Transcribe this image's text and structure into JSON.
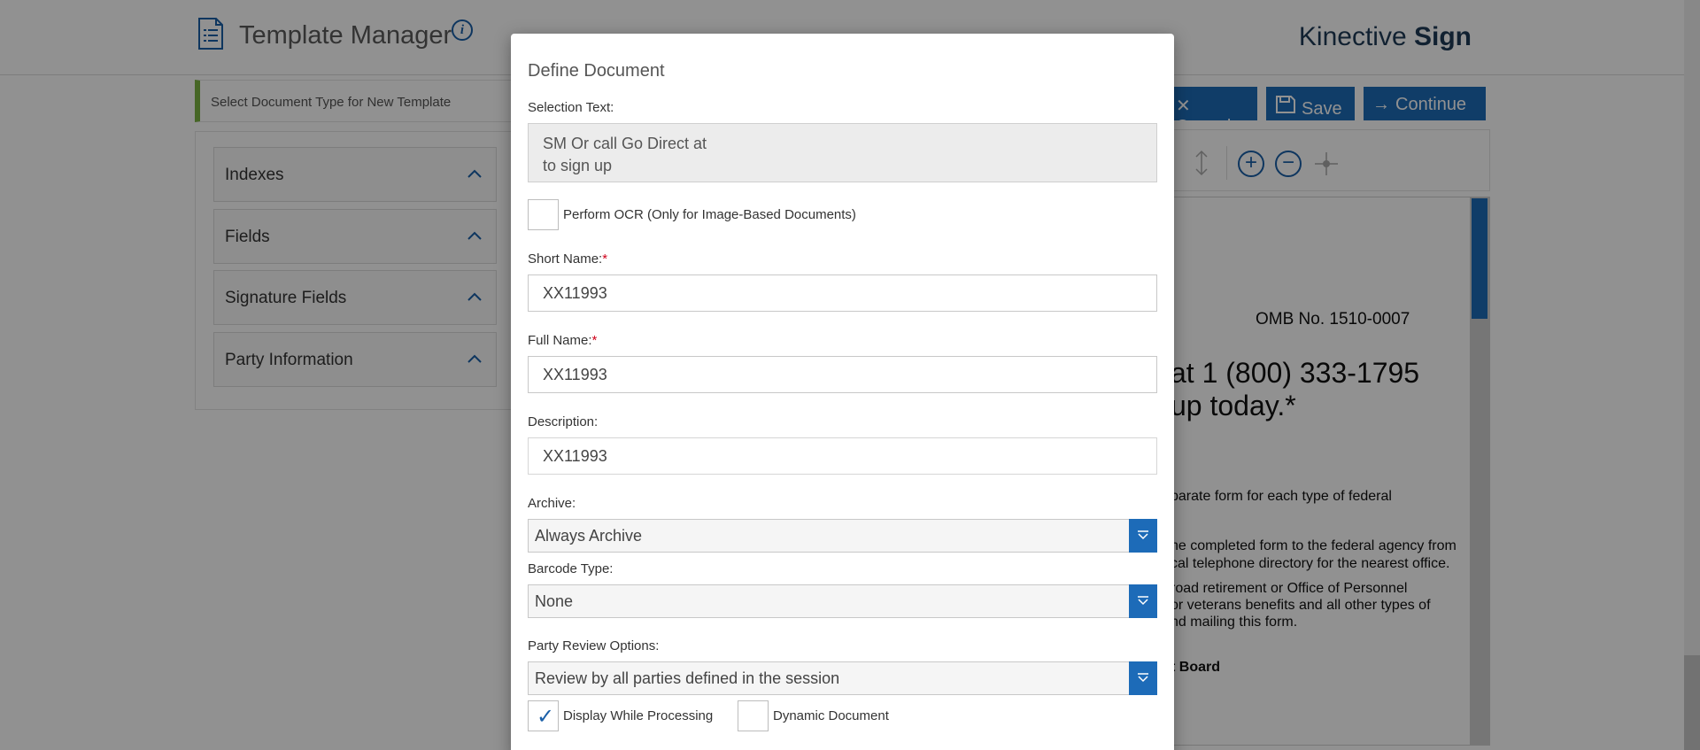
{
  "app": {
    "title": "Template Manager",
    "brand_light": "Kinective ",
    "brand_bold": "Sign"
  },
  "sidebar": {
    "doc_type_prompt": "Select Document Type for New Template",
    "sections": [
      {
        "label": "Indexes"
      },
      {
        "label": "Fields"
      },
      {
        "label": "Signature Fields"
      },
      {
        "label": "Party Information"
      }
    ]
  },
  "toolbar": {
    "cancel_label": "Cancel",
    "save_label": "Save",
    "continue_label": "Continue"
  },
  "document_preview": {
    "lines": [
      "OMB No. 1510-0007",
      "at 1 (800) 333-1795",
      "up today.*",
      "parate form for each type of federal",
      "he completed form to the federal agency from",
      "cal telephone directory for the nearest office.",
      "road retirement or Office of Personnel",
      "or veterans benefits and all other types of",
      "nd mailing this form.",
      "t Board"
    ]
  },
  "modal": {
    "title": "Define Document",
    "selection_text_label": "Selection Text:",
    "selection_text_value": "SM Or call Go Direct at\nto sign up",
    "ocr_label": "Perform OCR (Only for Image-Based Documents)",
    "ocr_checked": false,
    "short_name_label": "Short Name:",
    "short_name_value": "XX11993",
    "full_name_label": "Full Name:",
    "full_name_value": "XX11993",
    "required_marker": "*",
    "description_label": "Description:",
    "description_value": "XX11993",
    "archive_label": "Archive:",
    "archive_value": "Always Archive",
    "barcode_label": "Barcode Type:",
    "barcode_value": "None",
    "party_review_label": "Party Review Options:",
    "party_review_value": "Review by all parties defined in the session",
    "display_while_processing_label": "Display While Processing",
    "display_while_processing_checked": true,
    "dynamic_document_label": "Dynamic Document",
    "dynamic_document_checked": false
  },
  "colors": {
    "accent": "#1d6bb8",
    "required": "#d0021b",
    "green_marker": "#7cb342",
    "overlay": "rgba(0,0,0,0.43)"
  }
}
